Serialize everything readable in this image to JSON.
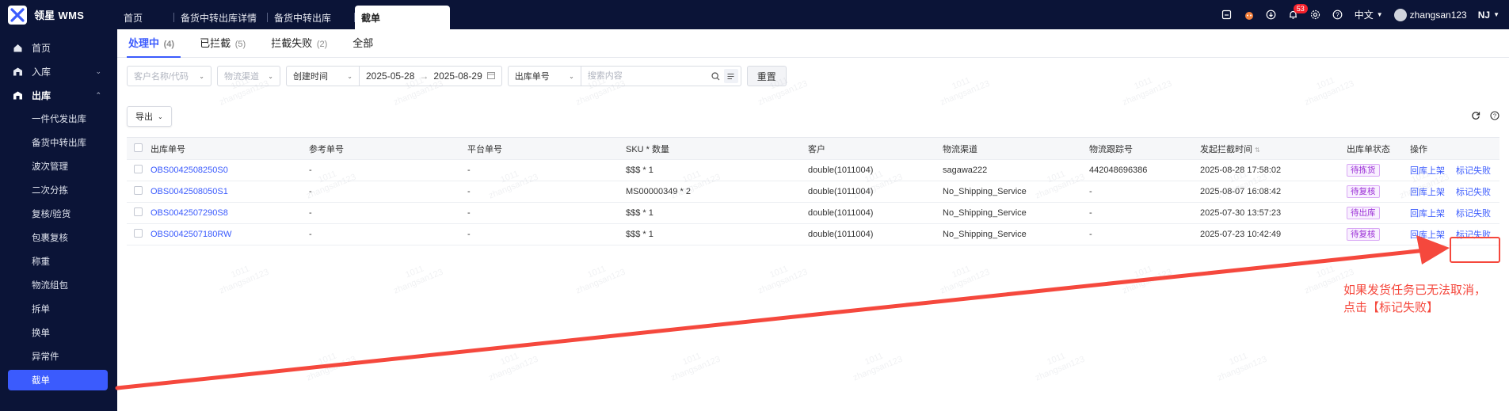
{
  "brand": {
    "name": "领星 WMS"
  },
  "top_tabs": [
    {
      "label": "首页"
    },
    {
      "label": "备货中转出库详情"
    },
    {
      "label": "备货中转出库"
    },
    {
      "label": "截单"
    }
  ],
  "top_right": {
    "notification_count": "53",
    "language": "中文",
    "username": "zhangsan123",
    "org": "NJ"
  },
  "sidebar": {
    "items": [
      {
        "label": "首页",
        "icon": "home-icon"
      },
      {
        "label": "入库",
        "icon": "inbound-icon"
      },
      {
        "label": "出库",
        "icon": "outbound-icon"
      }
    ],
    "sub_items": [
      "一件代发出库",
      "备货中转出库",
      "波次管理",
      "二次分拣",
      "复核/验货",
      "包裹复核",
      "称重",
      "物流组包",
      "拆单",
      "换单",
      "异常件",
      "截单"
    ]
  },
  "subtabs": [
    {
      "label": "处理中",
      "count": "(4)"
    },
    {
      "label": "已拦截",
      "count": "(5)"
    },
    {
      "label": "拦截失败",
      "count": "(2)"
    },
    {
      "label": "全部",
      "count": ""
    }
  ],
  "filters": {
    "customer_placeholder": "客户名称/代码",
    "channel_placeholder": "物流渠道",
    "date_type": "创建时间",
    "date_start": "2025-05-28",
    "date_end": "2025-08-29",
    "search_type": "出库单号",
    "search_placeholder": "搜索内容",
    "reset_label": "重置"
  },
  "toolbar": {
    "export_label": "导出"
  },
  "table": {
    "headers": [
      "出库单号",
      "参考单号",
      "平台单号",
      "SKU * 数量",
      "客户",
      "物流渠道",
      "物流跟踪号",
      "发起拦截时间",
      "出库单状态",
      "操作"
    ],
    "rows": [
      {
        "no": "OBS0042508250S0",
        "ref": "-",
        "plat": "-",
        "sku": "$$$ * 1",
        "cust": "double(1011004)",
        "chan": "sagawa222",
        "track": "442048696386",
        "time": "2025-08-28 17:58:02",
        "status": "待拣货",
        "op1": "回库上架",
        "op2": "标记失败"
      },
      {
        "no": "OBS0042508050S1",
        "ref": "-",
        "plat": "-",
        "sku": "MS00000349 * 2",
        "cust": "double(1011004)",
        "chan": "No_Shipping_Service",
        "track": "-",
        "time": "2025-08-07 16:08:42",
        "status": "待复核",
        "op1": "回库上架",
        "op2": "标记失败"
      },
      {
        "no": "OBS0042507290S8",
        "ref": "-",
        "plat": "-",
        "sku": "$$$ * 1",
        "cust": "double(1011004)",
        "chan": "No_Shipping_Service",
        "track": "-",
        "time": "2025-07-30 13:57:23",
        "status": "待出库",
        "op1": "回库上架",
        "op2": "标记失败"
      },
      {
        "no": "OBS0042507180RW",
        "ref": "-",
        "plat": "-",
        "sku": "$$$ * 1",
        "cust": "double(1011004)",
        "chan": "No_Shipping_Service",
        "track": "-",
        "time": "2025-07-23 10:42:49",
        "status": "待复核",
        "op1": "回库上架",
        "op2": "标记失败"
      }
    ]
  },
  "watermark": {
    "line1": "1011",
    "line2": "zhangsan123"
  },
  "annotation": {
    "line1": "如果发货任务已无法取消，",
    "line2": "点击【标记失败】",
    "color": "#f5483d"
  },
  "colors": {
    "nav_bg": "#0b1437",
    "accent": "#3b5bfd",
    "annotation": "#f5483d"
  }
}
